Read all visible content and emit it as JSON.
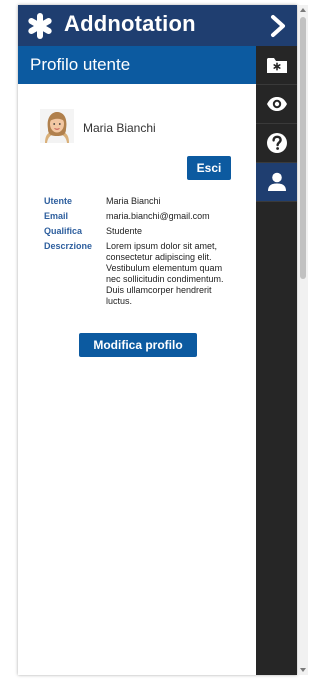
{
  "app": {
    "title": "Addnotation",
    "logo_icon": "asterisk-icon",
    "collapse_icon": "chevron-right-icon",
    "colors": {
      "header": "#1f3e70",
      "accent": "#0c5aa0",
      "sidebar": "#262626"
    }
  },
  "panel": {
    "title": "Profilo utente"
  },
  "user": {
    "display_name": "Maria Bianchi",
    "logout_label": "Esci",
    "fields": [
      {
        "label": "Utente",
        "value": "Maria Bianchi"
      },
      {
        "label": "Email",
        "value": "maria.bianchi@gmail.com"
      },
      {
        "label": "Qualifica",
        "value": "Studente"
      },
      {
        "label": "Descrzione",
        "value": "Lorem ipsum dolor sit amet, consectetur adipiscing elit. Vestibulum elementum quam nec sollicitudin condimentum. Duis ullamcorper hendrerit luctus."
      }
    ],
    "edit_label": "Modifica profilo"
  },
  "sidebar": {
    "tabs": [
      {
        "icon": "folder-asterisk-icon",
        "active": false
      },
      {
        "icon": "eye-icon",
        "active": false
      },
      {
        "icon": "help-icon",
        "active": false
      },
      {
        "icon": "user-icon",
        "active": true
      }
    ]
  }
}
